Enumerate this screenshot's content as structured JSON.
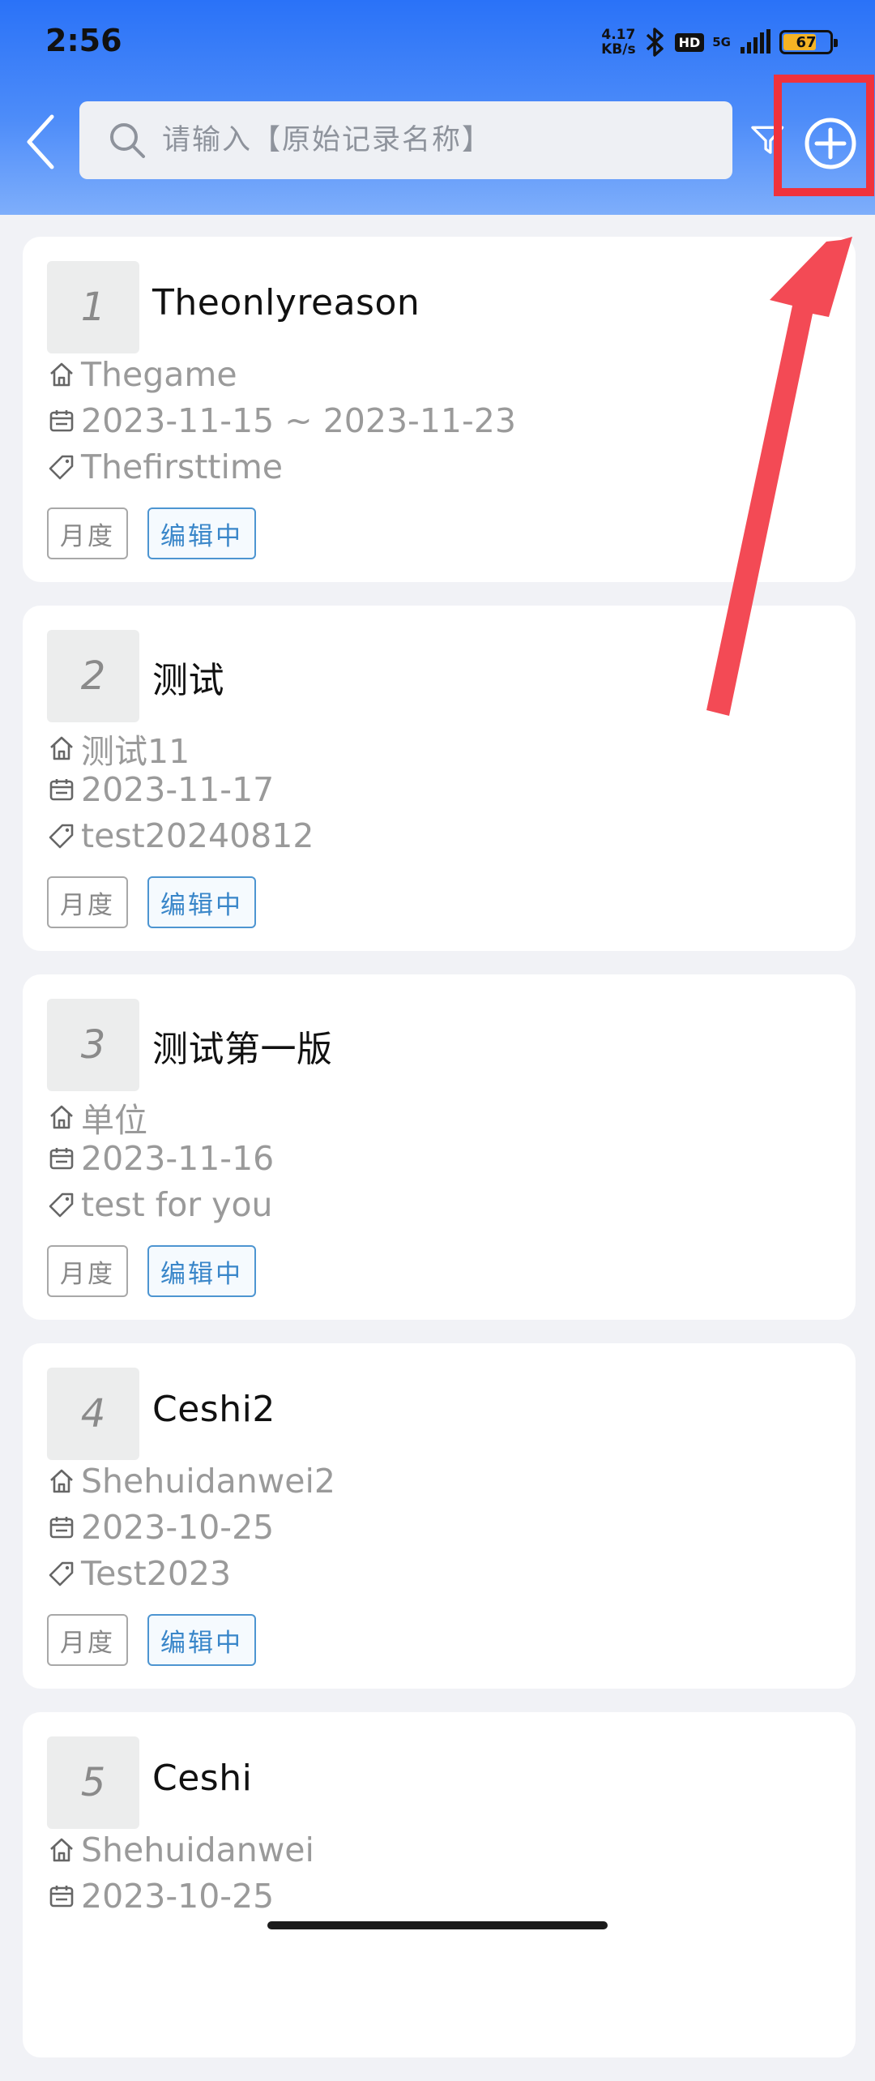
{
  "status_bar": {
    "time": "2:56",
    "net_speed_value": "4.17",
    "net_speed_unit": "KB/s",
    "hd": "HD",
    "network": "5G",
    "battery": "67"
  },
  "header": {
    "search_placeholder": "请输入【原始记录名称】",
    "icons": [
      "back-icon",
      "search-icon",
      "filter-icon",
      "add-circle-icon"
    ]
  },
  "records": [
    {
      "index": "1",
      "title": "Theonlyreason",
      "unit": "Thegame",
      "date": "2023-11-15 ~ 2023-11-23",
      "tag": "Thefirsttime",
      "period": "月度",
      "status": "编辑中"
    },
    {
      "index": "2",
      "title": "测试",
      "unit": "测试11",
      "date": "2023-11-17",
      "tag": "test20240812",
      "period": "月度",
      "status": "编辑中"
    },
    {
      "index": "3",
      "title": "测试第一版",
      "unit": "单位",
      "date": "2023-11-16",
      "tag": "test for you",
      "period": "月度",
      "status": "编辑中"
    },
    {
      "index": "4",
      "title": "Ceshi2",
      "unit": "Shehuidanwei2",
      "date": "2023-10-25",
      "tag": "Test2023",
      "period": "月度",
      "status": "编辑中"
    },
    {
      "index": "5",
      "title": "Ceshi",
      "unit": "Shehuidanwei",
      "date": "2023-10-25",
      "tag": "",
      "period": "",
      "status": ""
    }
  ],
  "colors": {
    "header_top": "#2a72f8",
    "accent_blue": "#3986c9",
    "annotation_red": "#f0323c"
  }
}
